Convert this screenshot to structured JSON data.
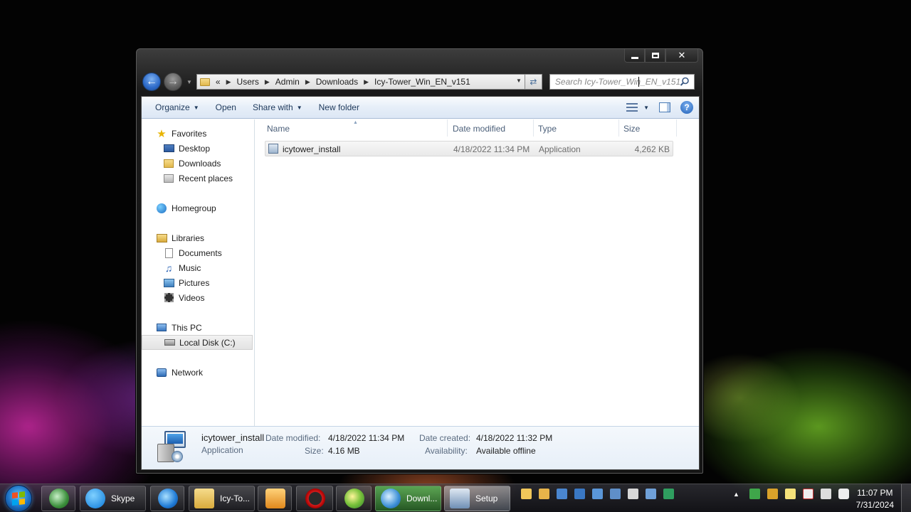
{
  "window": {
    "caption": {
      "minimize": "minimize",
      "maximize": "maximize",
      "close": "✕"
    },
    "breadcrumb": {
      "overflow": "«",
      "items": [
        "Users",
        "Admin",
        "Downloads",
        "Icy-Tower_Win_EN_v151"
      ]
    },
    "search": {
      "placeholder": "Search Icy-Tower_Win_EN_v151"
    },
    "toolbar": {
      "organize": "Organize",
      "open": "Open",
      "share_with": "Share with",
      "new_folder": "New folder",
      "help": "?"
    },
    "nav_pane": {
      "favorites": "Favorites",
      "desktop": "Desktop",
      "downloads": "Downloads",
      "recent_places": "Recent places",
      "homegroup": "Homegroup",
      "libraries": "Libraries",
      "documents": "Documents",
      "music": "Music",
      "pictures": "Pictures",
      "videos": "Videos",
      "this_pc": "This PC",
      "local_disk": "Local Disk (C:)",
      "network": "Network"
    },
    "columns": {
      "name": "Name",
      "date_modified": "Date modified",
      "type": "Type",
      "size": "Size"
    },
    "files": [
      {
        "name": "icytower_install",
        "date_modified": "4/18/2022 11:34 PM",
        "type": "Application",
        "size": "4,262 KB"
      }
    ],
    "details": {
      "name": "icytower_install",
      "kind": "Application",
      "date_modified_label": "Date modified:",
      "date_modified": "4/18/2022 11:34 PM",
      "size_label": "Size:",
      "size": "4.16 MB",
      "date_created_label": "Date created:",
      "date_created": "4/18/2022 11:32 PM",
      "availability_label": "Availability:",
      "availability": "Available offline"
    }
  },
  "taskbar": {
    "buttons": [
      {
        "label": "Skype",
        "icon": "skype-icon"
      },
      {
        "label": "Icy-To...",
        "icon": "folder-icon"
      },
      {
        "label": "Downl...",
        "icon": "browser-icon"
      },
      {
        "label": "Setup",
        "icon": "setup-icon"
      }
    ],
    "clock": {
      "time": "11:07 PM",
      "date": "7/31/2024"
    }
  },
  "colors": {
    "accent": "#2e6bc9",
    "toolbar_text": "#1e395b",
    "header_text": "#4c607a"
  }
}
